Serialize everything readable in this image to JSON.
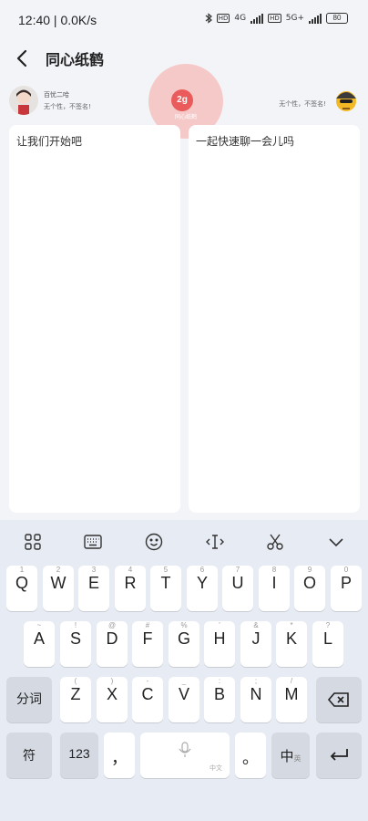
{
  "status": {
    "time": "12:40 | 0.0K/s",
    "net1": "4G",
    "net2": "5G+",
    "battery": "80"
  },
  "header": {
    "title": "同心纸鹤"
  },
  "users": {
    "left_name": "百忧二哈",
    "left_sig": "无个性，不签名!",
    "right_sig": "无个性，不签名!"
  },
  "badge": {
    "mark": "2g",
    "sub": "同心纸鹤"
  },
  "panels": {
    "left_text": "让我们开始吧",
    "right_text": "一起快速聊一会儿吗"
  },
  "keyboard": {
    "row1": [
      {
        "l": "Q",
        "h": "1"
      },
      {
        "l": "W",
        "h": "2"
      },
      {
        "l": "E",
        "h": "3"
      },
      {
        "l": "R",
        "h": "4"
      },
      {
        "l": "T",
        "h": "5"
      },
      {
        "l": "Y",
        "h": "6"
      },
      {
        "l": "U",
        "h": "7"
      },
      {
        "l": "I",
        "h": "8"
      },
      {
        "l": "O",
        "h": "9"
      },
      {
        "l": "P",
        "h": "0"
      }
    ],
    "row2": [
      {
        "l": "A",
        "h": "~"
      },
      {
        "l": "S",
        "h": "!"
      },
      {
        "l": "D",
        "h": "@"
      },
      {
        "l": "F",
        "h": "#"
      },
      {
        "l": "G",
        "h": "%"
      },
      {
        "l": "H",
        "h": "'"
      },
      {
        "l": "J",
        "h": "&"
      },
      {
        "l": "K",
        "h": "*"
      },
      {
        "l": "L",
        "h": "?"
      }
    ],
    "row3": [
      {
        "l": "Z",
        "h": "("
      },
      {
        "l": "X",
        "h": ")"
      },
      {
        "l": "C",
        "h": "-"
      },
      {
        "l": "V",
        "h": "_"
      },
      {
        "l": "B",
        "h": ":"
      },
      {
        "l": "N",
        "h": ";"
      },
      {
        "l": "M",
        "h": "/"
      }
    ],
    "split": "分词",
    "symbols": "符",
    "num": "123",
    "comma": "，",
    "period": "。",
    "space_hint": "中文",
    "lang": "中",
    "lang_sub": "英"
  }
}
